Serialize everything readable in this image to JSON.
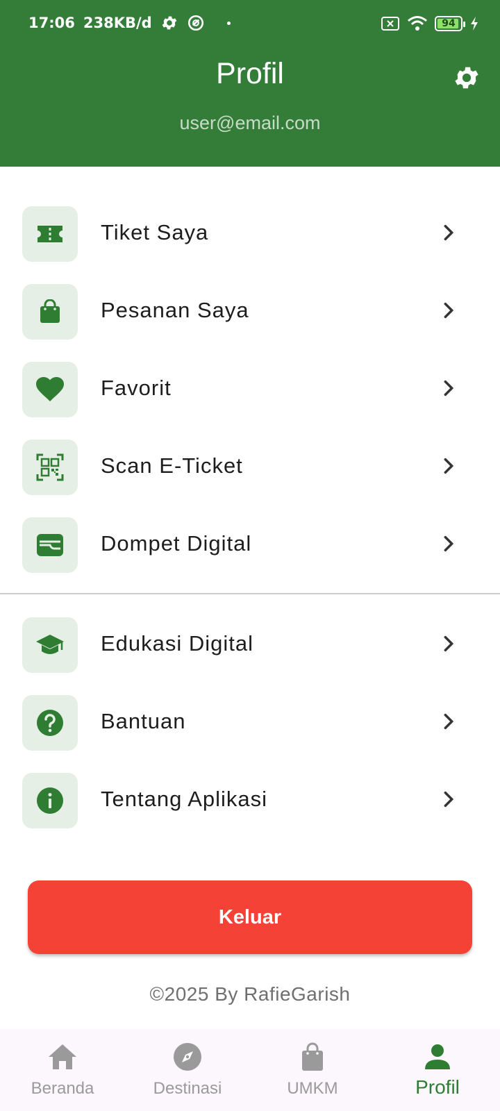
{
  "status_bar": {
    "time": "17:06",
    "network_speed": "238KB/d",
    "battery_level": "94",
    "battery_fraction": 0.94
  },
  "header": {
    "title": "Profil",
    "email": "user@email.com",
    "background_color": "#347d39"
  },
  "menu": {
    "section1": [
      {
        "label": "Tiket Saya",
        "icon": "ticket-icon"
      },
      {
        "label": "Pesanan Saya",
        "icon": "shopping-bag-icon"
      },
      {
        "label": "Favorit",
        "icon": "heart-icon"
      },
      {
        "label": "Scan E-Ticket",
        "icon": "qr-code-icon"
      },
      {
        "label": "Dompet Digital",
        "icon": "wallet-icon"
      }
    ],
    "section2": [
      {
        "label": "Edukasi Digital",
        "icon": "graduation-cap-icon"
      },
      {
        "label": "Bantuan",
        "icon": "help-icon"
      },
      {
        "label": "Tentang Aplikasi",
        "icon": "info-icon"
      }
    ],
    "icon_color": "#2e7d32",
    "icon_bg_color": "#e6efe6"
  },
  "logout": {
    "label": "Keluar",
    "color": "#f44336"
  },
  "footer": {
    "copyright": "©2025 By RafieGarish"
  },
  "bottom_nav": {
    "items": [
      {
        "label": "Beranda",
        "icon": "home-icon"
      },
      {
        "label": "Destinasi",
        "icon": "compass-icon"
      },
      {
        "label": "UMKM",
        "icon": "shopping-bag-icon"
      },
      {
        "label": "Profil",
        "icon": "person-icon",
        "active": true
      }
    ],
    "active_color": "#2e7d32",
    "inactive_color": "#9a9a9a"
  }
}
